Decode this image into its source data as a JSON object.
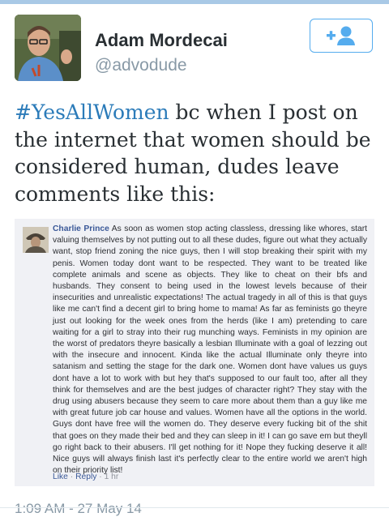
{
  "profile": {
    "display_name": "Adam Mordecai",
    "handle": "@advodude"
  },
  "follow_button": {
    "icon": "add-user-icon",
    "label": "+",
    "color": "#55acee"
  },
  "tweet": {
    "hashtag": "#YesAllWomen",
    "text": " bc when I post on the internet that women should be considered human, dudes leave comments like this:",
    "timestamp": "1:09 AM - 27 May 14"
  },
  "embedded_comment": {
    "commenter": "Charlie Prince",
    "body": "As soon as women stop acting classless, dressing like whores, start valuing themselves by not putting out to all these dudes, figure out what they actually want, stop friend zoning the nice guys, then I will stop breaking their spirit with my penis. Women today dont want to be respected. They want to be treated like complete animals and scene as objects. They like to cheat on their bfs and husbands. They consent to being used in the lowest levels because of their insecurities and unrealistic expectations! The actual tragedy in all of this is that guys like me can't find a decent girl to bring home to mama! As far as feminists go theyre just out looking for the week ones from the herds (like I am) pretending to care waiting for a girl to stray into their rug munching ways. Feminists in my opinion are the worst of predators theyre basically a lesbian Illuminate with a goal of lezzing out with the insecure and innocent. Kinda like the actual Illuminate only theyre into satanism and setting the stage for the dark one. Women dont have values us guys dont have a lot to work with but hey that's supposed to our fault too, after all they think for themselves and are the best judges of character right? They stay with the drug using abusers because they seem to care more about them than a guy like me with great future job car house and values. Women have all the options in the world. Guys dont have free will the women do. They deserve every fucking bit of the shit that goes on they made their bed and they can sleep in it! I can go save em but theyll go right back to their abusers. I'll get nothing for it! Nope they fucking deserve it all! Nice guys will always finish last it's perfectly clear to the entire world we aren't high on their priority list!",
    "actions": {
      "like": "Like",
      "separator": "·",
      "reply": "Reply",
      "age": "1 hr"
    }
  }
}
